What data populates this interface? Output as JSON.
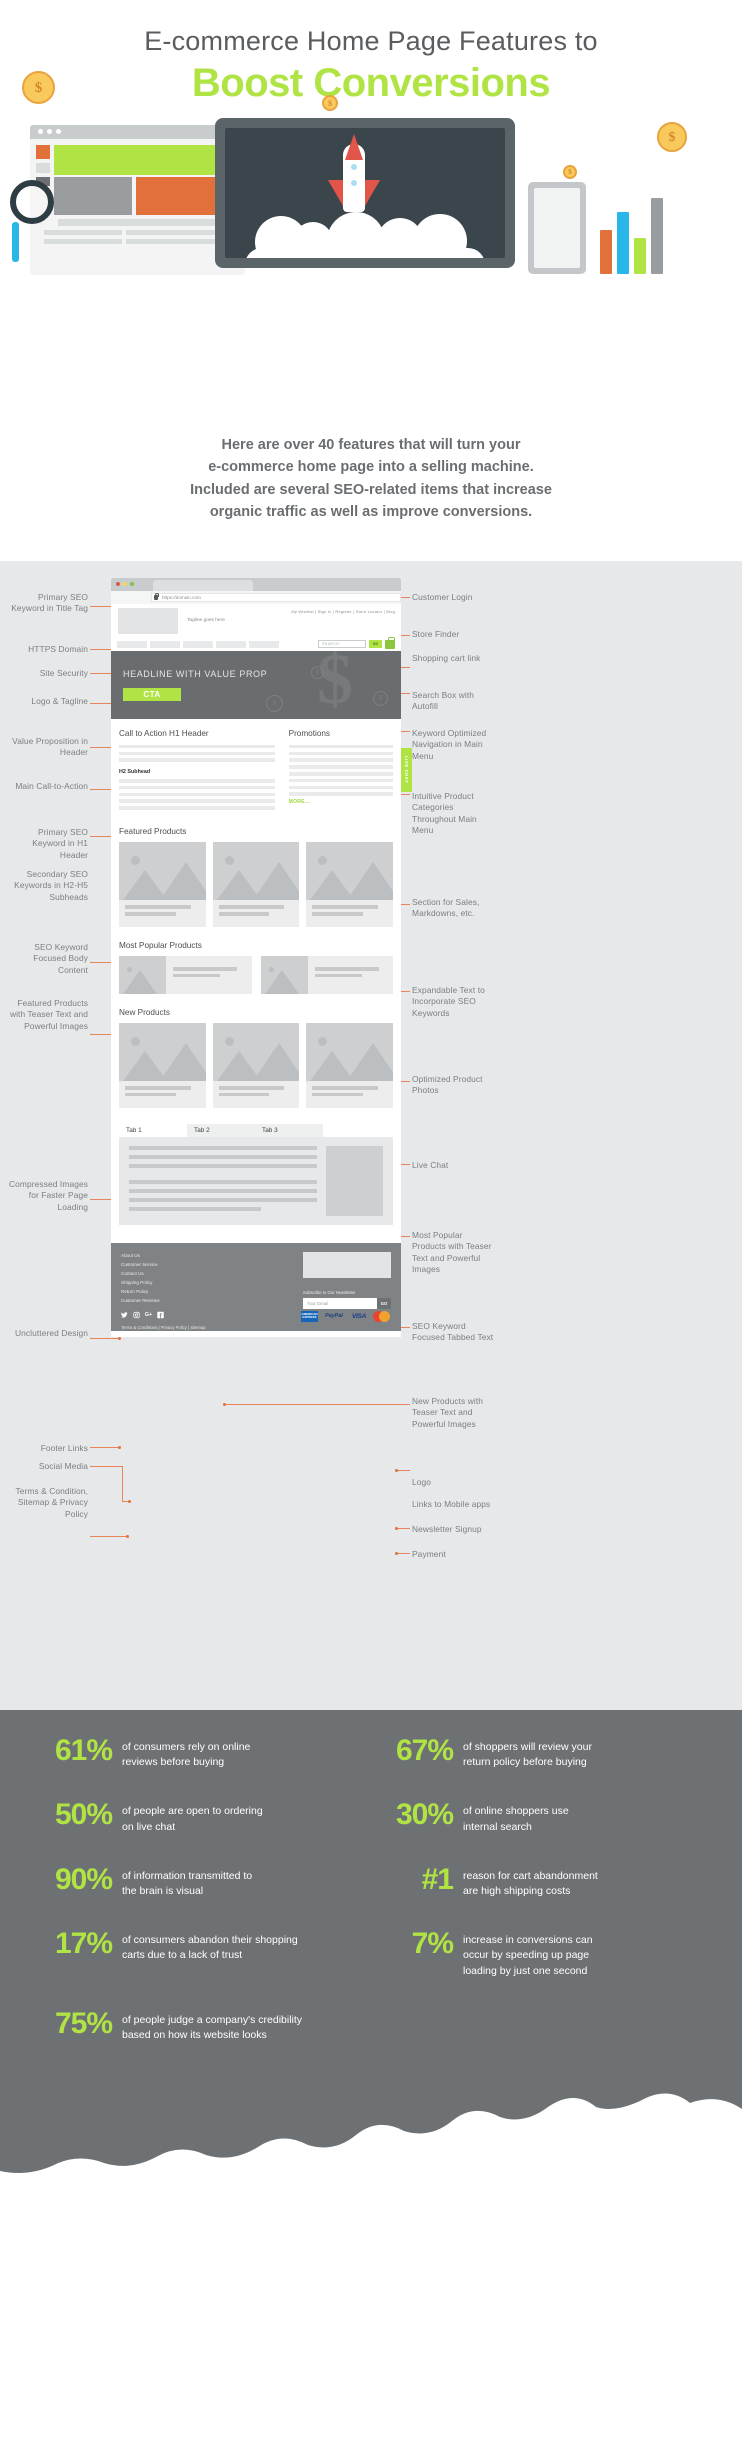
{
  "hero": {
    "title_line1": "E-commerce Home Page Features to",
    "title_line2": "Boost Conversions",
    "coin_glyph": "$",
    "accent_green": "#b0e445",
    "accent_orange": "#e2703a",
    "dark_gray": "#6e7173"
  },
  "intro": {
    "line1": "Here are over 40 features that will turn your",
    "line2": "e-commerce home page into a selling machine.",
    "line3": "Included are several SEO-related items that increase",
    "line4": "organic traffic as well as improve conversions."
  },
  "annotations_left": [
    {
      "id": "primary-seo-title-tag",
      "text": "Primary SEO Keyword in Title Tag"
    },
    {
      "id": "https-domain",
      "text": "HTTPS Domain"
    },
    {
      "id": "site-security",
      "text": "Site Security"
    },
    {
      "id": "logo-tagline",
      "text": "Logo & Tagline"
    },
    {
      "id": "value-proposition",
      "text": "Value Proposition in Header"
    },
    {
      "id": "main-cta",
      "text": "Main Call-to-Action"
    },
    {
      "id": "primary-seo-h1",
      "text": "Primary SEO Keyword in H1 Header"
    },
    {
      "id": "secondary-seo",
      "text": "Secondary SEO Keywords in H2-H5 Subheads"
    },
    {
      "id": "seo-body-content",
      "text": "SEO Keyword Focused Body  Content"
    },
    {
      "id": "featured-products",
      "text": "Featured Products with Teaser Text and Powerful Images"
    },
    {
      "id": "compressed-images",
      "text": "Compressed Images for Faster Page Loading"
    },
    {
      "id": "uncluttered-design",
      "text": "Uncluttered Design"
    },
    {
      "id": "footer-links",
      "text": "Footer Links"
    },
    {
      "id": "social-media",
      "text": "Social Media"
    },
    {
      "id": "terms-sitemap-privacy",
      "text": "Terms & Condition, Sitemap & Privacy Policy"
    }
  ],
  "annotations_right": [
    {
      "id": "customer-login",
      "text": "Customer Login"
    },
    {
      "id": "store-finder",
      "text": "Store Finder"
    },
    {
      "id": "shopping-cart-link",
      "text": "Shopping cart link"
    },
    {
      "id": "search-box-autofill",
      "text": "Search Box with Autofill"
    },
    {
      "id": "keyword-optimized-nav",
      "text": "Keyword Optimized Navigation in Main Menu"
    },
    {
      "id": "intuitive-product-categories",
      "text": "Intuitive Product Categories Throughout Main Menu"
    },
    {
      "id": "section-sales-markdowns",
      "text": "Section for Sales, Markdowns, etc."
    },
    {
      "id": "expandable-text",
      "text": "Expandable Text to Incorporate SEO Keywords"
    },
    {
      "id": "optimized-product-photos",
      "text": "Optimized Product Photos"
    },
    {
      "id": "live-chat",
      "text": "Live Chat"
    },
    {
      "id": "most-popular-products",
      "text": "Most Popular Products with Teaser Text and Powerful Images"
    },
    {
      "id": "new-products",
      "text": "New Products with Teaser Text and Powerful Images"
    },
    {
      "id": "seo-tabbed-text",
      "text": "SEO Keyword Focused Tabbed Text"
    },
    {
      "id": "logo",
      "text": "Logo"
    },
    {
      "id": "mobile-apps",
      "text": "Links to Mobile apps"
    },
    {
      "id": "newsletter-signup",
      "text": "Newsletter Signup"
    },
    {
      "id": "payment",
      "text": "Payment"
    }
  ],
  "mock": {
    "url": "https://domain.com",
    "tagline": "Tagline goes here",
    "toplinks": "My Wishlist  |  Sign In  |  Register  |  Store Locator  |  Blog",
    "search_placeholder": "SEARCH",
    "go_label": "GO",
    "hero_headline": "HEADLINE WITH VALUE PROP",
    "cta_label": "CTA",
    "h1_header": "Call to Action H1 Header",
    "h2_subhead": "H2 Subhead",
    "promotions_title": "Promotions",
    "more_label": "MORE...",
    "featured_title": "Featured Products",
    "most_popular_title": "Most Popular Products",
    "new_products_title": "New Products",
    "live_chat_label": "LIVE CHAT",
    "dollar_glyph": "$",
    "tabs": [
      {
        "label": "Tab 1",
        "active": true
      },
      {
        "label": "Tab 2",
        "active": false
      },
      {
        "label": "Tab 3",
        "active": false
      }
    ],
    "footer": {
      "links": [
        "About Us",
        "Customer Service",
        "Contact Us",
        "Shipping Policy",
        "Return Policy",
        "Customer Reviews"
      ],
      "social": [
        "twitter-icon",
        "instagram-icon",
        "googleplus-icon",
        "facebook-icon"
      ],
      "social_glyphs": [
        "ᴠ",
        "▣",
        "G+",
        "f"
      ],
      "legal": "Terms & Conditions  |  Privacy Policy  |  Sitemap",
      "newsletter_label": "Subscribe to Our Newsletter",
      "email_placeholder": "Your Email",
      "newsletter_go": "GO",
      "payments": [
        "AMERICAN EXPRESS",
        "PayPal",
        "VISA",
        "mastercard"
      ]
    }
  },
  "stats": [
    {
      "num": "61%",
      "text_line1": "of consumers rely on online",
      "text_line2": "reviews before buying"
    },
    {
      "num": "67%",
      "text_line1": "of shoppers will review your",
      "text_line2": "return policy before buying"
    },
    {
      "num": "50%",
      "text_line1": "of people are open to ordering",
      "text_line2": "on live chat"
    },
    {
      "num": "30%",
      "text_line1": "of online shoppers use",
      "text_line2": " internal search"
    },
    {
      "num": "90%",
      "text_line1": "of information transmitted to",
      "text_line2": "the brain is visual"
    },
    {
      "num": "#1",
      "text_line1": "reason for cart abandonment",
      "text_line2": "are high shipping costs"
    },
    {
      "num": "17%",
      "text_line1": "of consumers abandon their shopping",
      "text_line2": "carts due to a lack of trust"
    },
    {
      "num": "7%",
      "text_line1": "increase in conversions can",
      "text_line2": "occur by speeding up page",
      "text_line3": "loading by just one second"
    },
    {
      "num": "75%",
      "text_line1": "of people judge a company's credibility",
      "text_line2": "based on how its website looks"
    }
  ]
}
